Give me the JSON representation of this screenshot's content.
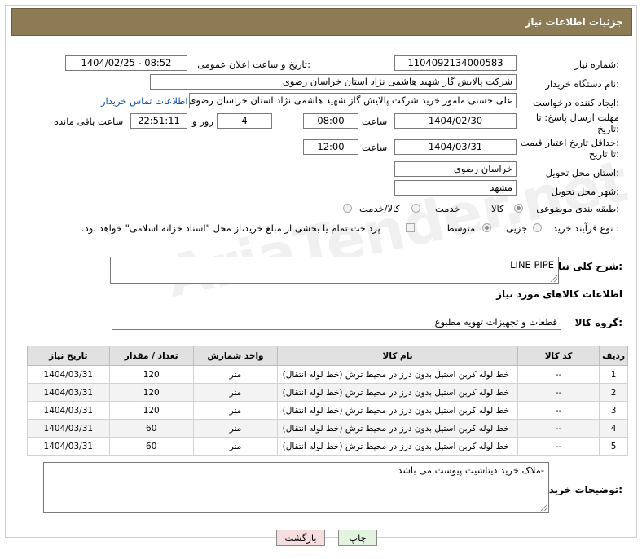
{
  "header": {
    "title": "جزئیات اطلاعات نیاز"
  },
  "form": {
    "need_number": {
      "label": "شماره نیاز:",
      "value": "1104092134000583"
    },
    "announce_datetime": {
      "label": "تاریخ و ساعت اعلان عمومی:",
      "value": "1404/02/25 - 08:52"
    },
    "buyer_org": {
      "label": "نام دستگاه خریدار:",
      "value": "شرکت پالایش گاز شهید هاشمی نژاد   استان خراسان رضوی"
    },
    "requester": {
      "label": "ایجاد کننده درخواست:",
      "value": "علی حسنی مامور خرید شرکت پالایش گاز شهید هاشمی نژاد   استان خراسان رضوی",
      "contact_link": "اطلاعات تماس خریدار"
    },
    "reply_deadline": {
      "label_line1": "مهلت ارسال پاسخ: تا",
      "label_line2": "تاریخ:",
      "date": "1404/02/30",
      "time_label": "ساعت",
      "time": "08:00",
      "days": "4",
      "days_label": "روز و",
      "remaining_time": "22:51:11",
      "remaining_label": "ساعت باقی مانده"
    },
    "price_validity": {
      "label_line1": "حداقل تاریخ اعتبار قیمت:",
      "label_line2": "تا تاریخ:",
      "date": "1404/03/31",
      "time_label": "ساعت",
      "time": "12:00"
    },
    "delivery_province": {
      "label": "استان محل تحویل:",
      "value": "خراسان رضوی"
    },
    "delivery_city": {
      "label": "شهر محل تحویل:",
      "value": "مشهد"
    },
    "category": {
      "label": "طبقه بندی موضوعی:",
      "options": [
        "کالا",
        "خدمت",
        "کالا/خدمت"
      ],
      "selected": "کالا"
    },
    "purchase_process": {
      "label": "نوع فرآیند خرید :",
      "options": [
        "جزیی",
        "متوسط"
      ],
      "note": "پرداخت تمام یا بخشی از مبلغ خرید،از محل \"اسناد خزانه اسلامی\" خواهد بود."
    },
    "general_description": {
      "label": "شرح کلی نیاز:",
      "value": "LINE PIPE"
    },
    "goods_section_title": "اطلاعات کالاهای مورد نیاز",
    "goods_group": {
      "label": "گروه کالا:",
      "value": "قطعات و تجهیزات تهویه مطبوع"
    }
  },
  "table": {
    "headers": [
      "ردیف",
      "کد کالا",
      "نام کالا",
      "واحد شمارش",
      "تعداد / مقدار",
      "تاریخ نیاز"
    ],
    "rows": [
      [
        "1",
        "--",
        "خط لوله کربن استیل بدون درز در محیط ترش (خط لوله انتقال)",
        "متر",
        "120",
        "1404/03/31"
      ],
      [
        "2",
        "--",
        "خط لوله کربن استیل بدون درز در محیط ترش (خط لوله انتقال)",
        "متر",
        "120",
        "1404/03/31"
      ],
      [
        "3",
        "--",
        "خط لوله کربن استیل بدون درز در محیط ترش (خط لوله انتقال)",
        "متر",
        "120",
        "1404/03/31"
      ],
      [
        "4",
        "--",
        "خط لوله کربن استیل بدون درز در محیط ترش (خط لوله انتقال)",
        "متر",
        "60",
        "1404/03/31"
      ],
      [
        "5",
        "--",
        "خط لوله کربن استیل بدون درز در محیط ترش (خط لوله انتقال)",
        "متر",
        "60",
        "1404/03/31"
      ]
    ]
  },
  "buyer_notes": {
    "label": "توضیحات خریدار:",
    "value": "-ملاک خرید دیتاشیت پیوست می باشد"
  },
  "buttons": {
    "print": "چاپ",
    "back": "بازگشت"
  },
  "watermark": "AriaTender.net",
  "colors": {
    "header_bg": "#8c7b54",
    "link": "#0a4fa3",
    "back_button_bg": "#f6dede",
    "print_button_bg": "#e3f3df"
  }
}
